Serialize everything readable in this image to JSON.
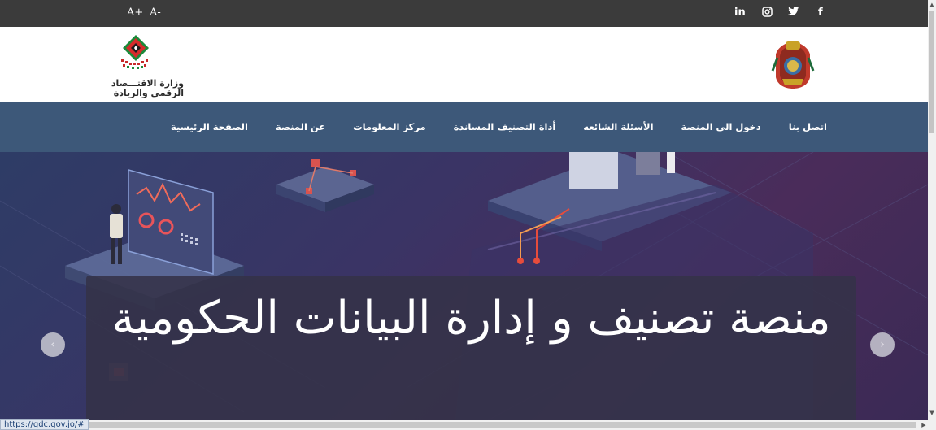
{
  "topbar": {
    "font_increase": "A+",
    "font_decrease": "A-",
    "social": [
      {
        "name": "facebook-icon",
        "glyph": "f"
      },
      {
        "name": "twitter-icon",
        "glyph": "🐦"
      },
      {
        "name": "instagram-icon",
        "glyph": "◎"
      },
      {
        "name": "linkedin-icon",
        "glyph": "in"
      }
    ]
  },
  "header": {
    "ministry_name_line1": "وزارة الاقتـــصاد",
    "ministry_name_line2": "الرقمي والريادة"
  },
  "nav": {
    "items": [
      "الصفحة الرئيسية",
      "عن المنصة",
      "مركز المعلومات",
      "أداة التصنيف المساندة",
      "الأسئلة الشائعه",
      "دخول الى المنصة",
      "اتصل بنا"
    ]
  },
  "hero": {
    "caption": "منصة تصنيف و إدارة البيانات الحكومية",
    "prev_arrow": "‹",
    "next_arrow": "›"
  },
  "status": {
    "url": "https://gdc.gov.jo/#"
  },
  "colors": {
    "topbar": "#3b3b3b",
    "nav": "#3d5879",
    "hero_accent": "#e74c3c"
  }
}
